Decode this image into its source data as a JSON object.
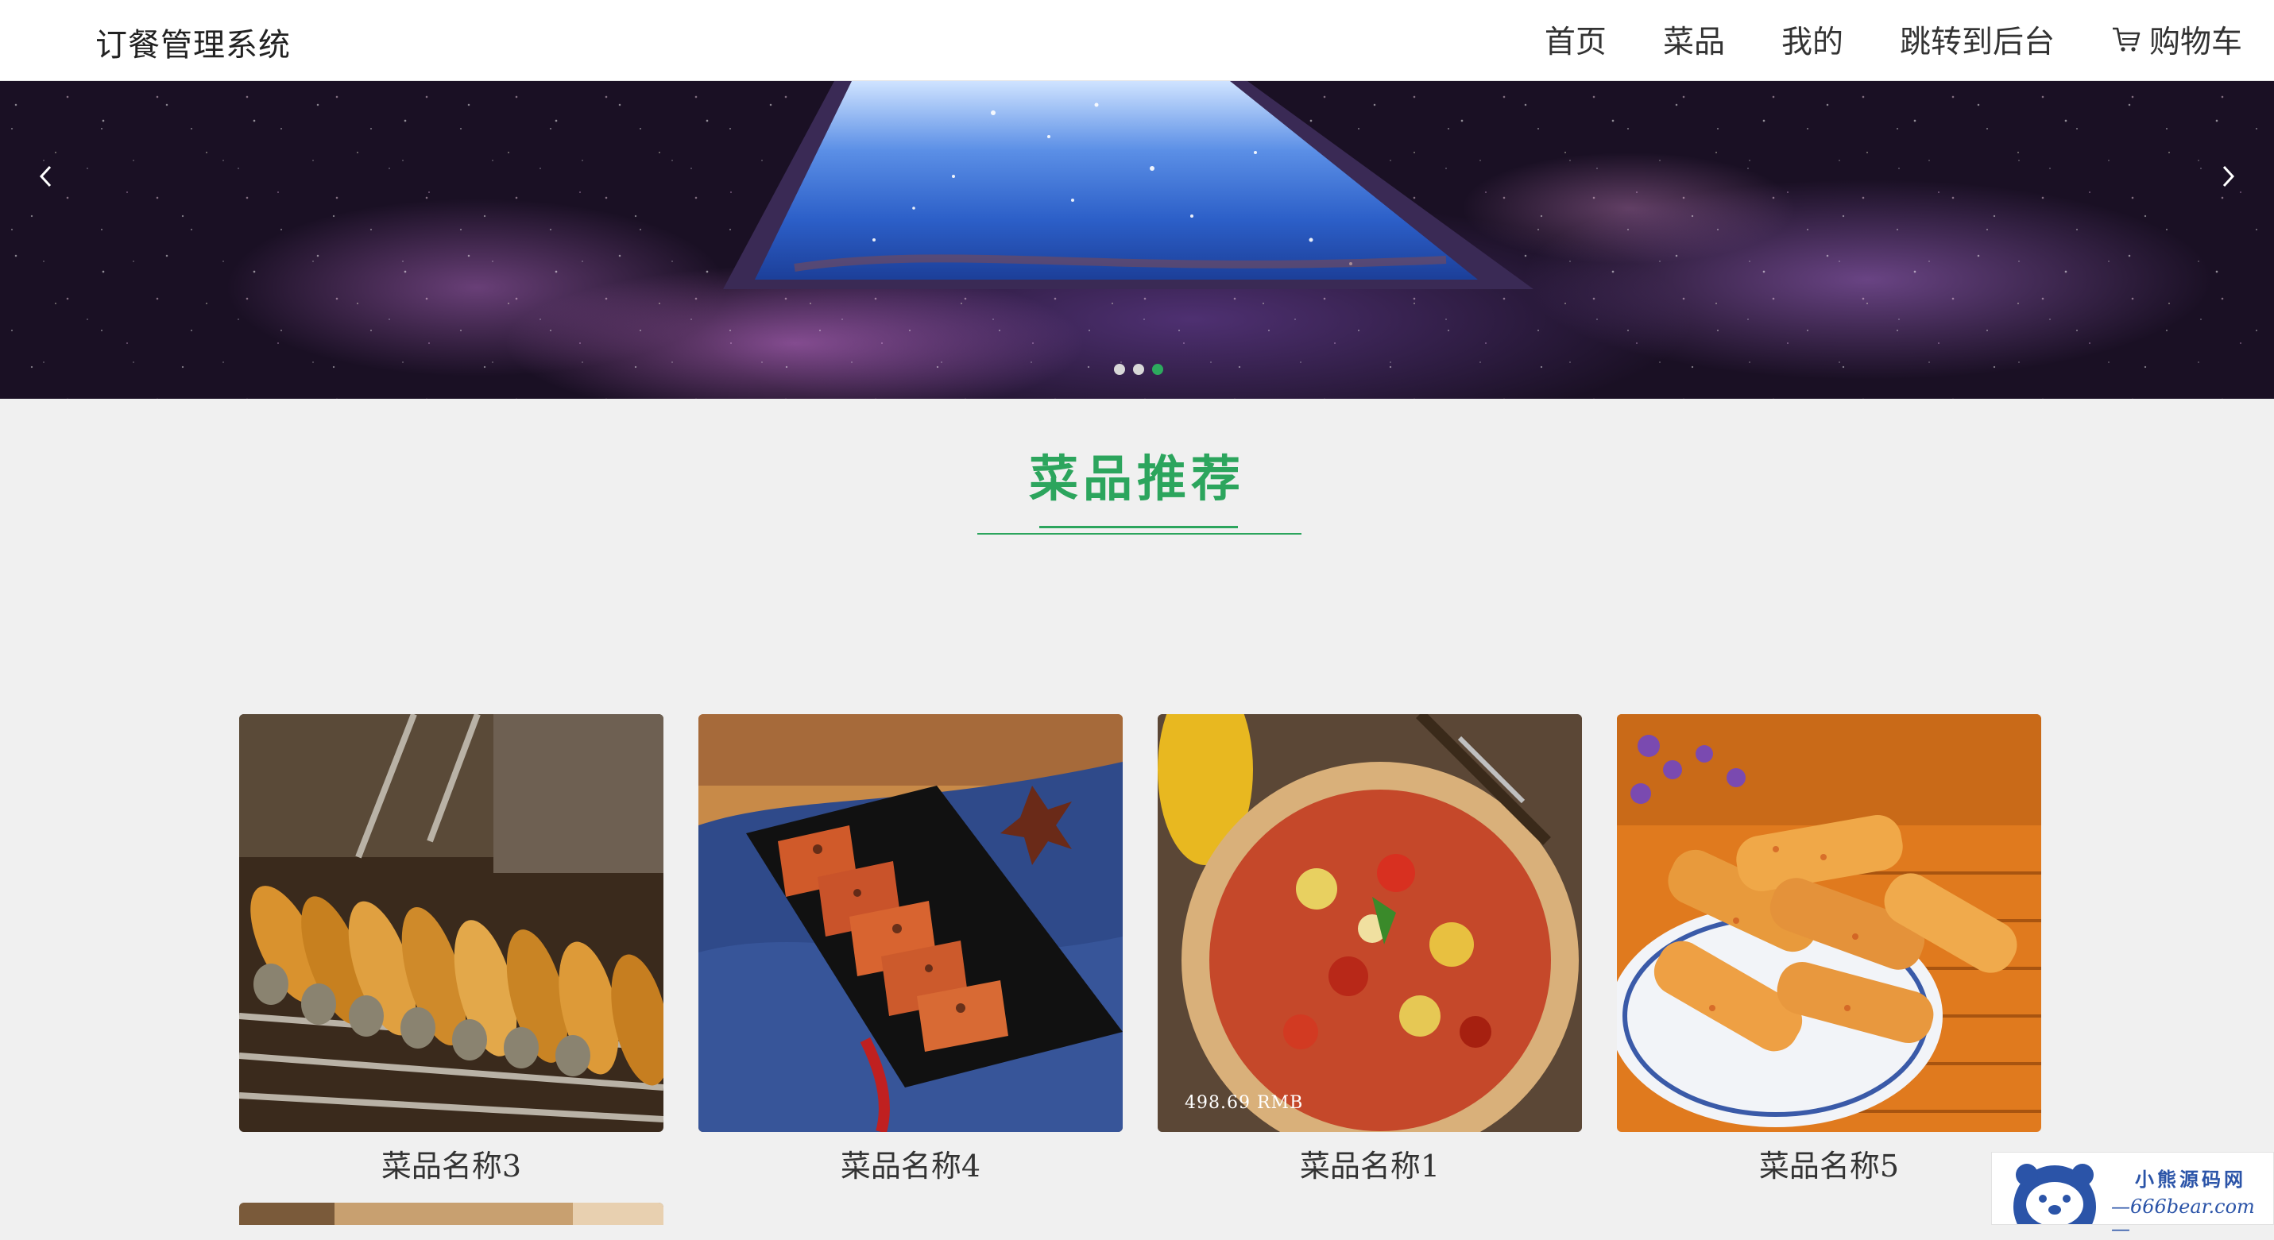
{
  "brand": "订餐管理系统",
  "nav": {
    "home": "首页",
    "dishes": "菜品",
    "mine": "我的",
    "admin": "跳转到后台",
    "cart": "购物车"
  },
  "carousel": {
    "slides": 3,
    "active_index": 2
  },
  "section_title": "菜品推荐",
  "dishes": [
    {
      "name": "菜品名称3",
      "price": ""
    },
    {
      "name": "菜品名称4",
      "price": ""
    },
    {
      "name": "菜品名称1",
      "price": "498.69 RMB"
    },
    {
      "name": "菜品名称5",
      "price": ""
    }
  ],
  "watermark": {
    "line1": "小熊源码网",
    "line2": "—666bear.com—"
  },
  "colors": {
    "accent": "#2ca55d",
    "nav_bg": "#ffffff",
    "page_bg": "#f0f0f0"
  },
  "icons": {
    "cart": "cart-icon",
    "prev": "chevron-left-icon",
    "next": "chevron-right-icon"
  }
}
